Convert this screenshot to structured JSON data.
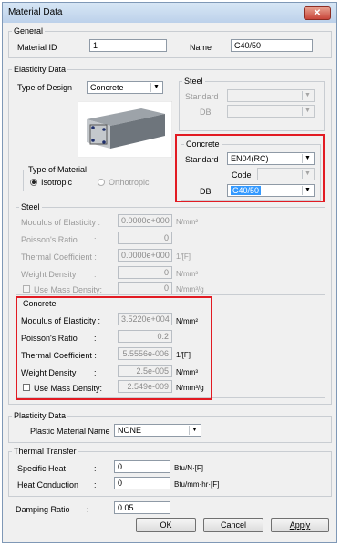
{
  "window": {
    "title": "Material Data",
    "close_symbol": "✕"
  },
  "general": {
    "group_label": "General",
    "material_id_label": "Material ID",
    "material_id_value": "1",
    "name_label": "Name",
    "name_value": "C40/50"
  },
  "elasticity": {
    "group_label": "Elasticity Data",
    "type_of_design_label": "Type of Design",
    "type_of_design_value": "Concrete",
    "steel_sub": {
      "label": "Steel",
      "standard_label": "Standard",
      "db_label": "DB"
    },
    "concrete_sub": {
      "label": "Concrete",
      "standard_label": "Standard",
      "standard_value": "EN04(RC)",
      "code_label": "Code",
      "db_label": "DB",
      "db_value": "C40/50"
    },
    "type_of_material": {
      "label": "Type of Material",
      "isotropic": "Isotropic",
      "orthotropic": "Orthotropic",
      "selected": "Isotropic"
    }
  },
  "steel_props": {
    "group_label": "Steel",
    "rows": [
      {
        "label": "Modulus of Elasticity :",
        "value": "0.0000e+000",
        "unit": "N/mm²"
      },
      {
        "label": "Poisson's Ratio",
        "colon": ":",
        "value": "0",
        "unit": ""
      },
      {
        "label": "Thermal Coefficient :",
        "value": "0.0000e+000",
        "unit": "1/[F]"
      },
      {
        "label": "Weight Density",
        "colon": ":",
        "value": "0",
        "unit": "N/mm³"
      },
      {
        "label": "Use Mass Density:",
        "value": "0",
        "unit": "N/mm³/g"
      }
    ]
  },
  "concrete_props": {
    "group_label": "Concrete",
    "rows": [
      {
        "label": "Modulus of Elasticity :",
        "value": "3.5220e+004",
        "unit": "N/mm²"
      },
      {
        "label": "Poisson's Ratio",
        "colon": ":",
        "value": "0.2",
        "unit": ""
      },
      {
        "label": "Thermal Coefficient :",
        "value": "5.5556e-006",
        "unit": "1/[F]"
      },
      {
        "label": "Weight Density",
        "colon": ":",
        "value": "2.5e-005",
        "unit": "N/mm³"
      },
      {
        "label": "Use Mass Density:",
        "value": "2.549e-009",
        "unit": "N/mm³/g"
      }
    ]
  },
  "plasticity": {
    "group_label": "Plasticity Data",
    "plastic_material_name_label": "Plastic Material Name",
    "plastic_material_name_value": "NONE"
  },
  "thermal": {
    "group_label": "Thermal Transfer",
    "specific_heat_label": "Specific Heat",
    "specific_heat_value": "0",
    "specific_heat_unit": "Btu/N·[F]",
    "heat_conduction_label": "Heat Conduction",
    "heat_conduction_value": "0",
    "heat_conduction_unit": "Btu/mm·hr·[F]",
    "colon": ":"
  },
  "damping": {
    "label": "Damping Ratio",
    "colon": ":",
    "value": "0.05"
  },
  "buttons": {
    "ok": "OK",
    "cancel": "Cancel",
    "apply": "Apply"
  },
  "colors": {
    "highlight": "#e21b23",
    "title_bar": "#c9dbef",
    "selection": "#3399ff"
  }
}
